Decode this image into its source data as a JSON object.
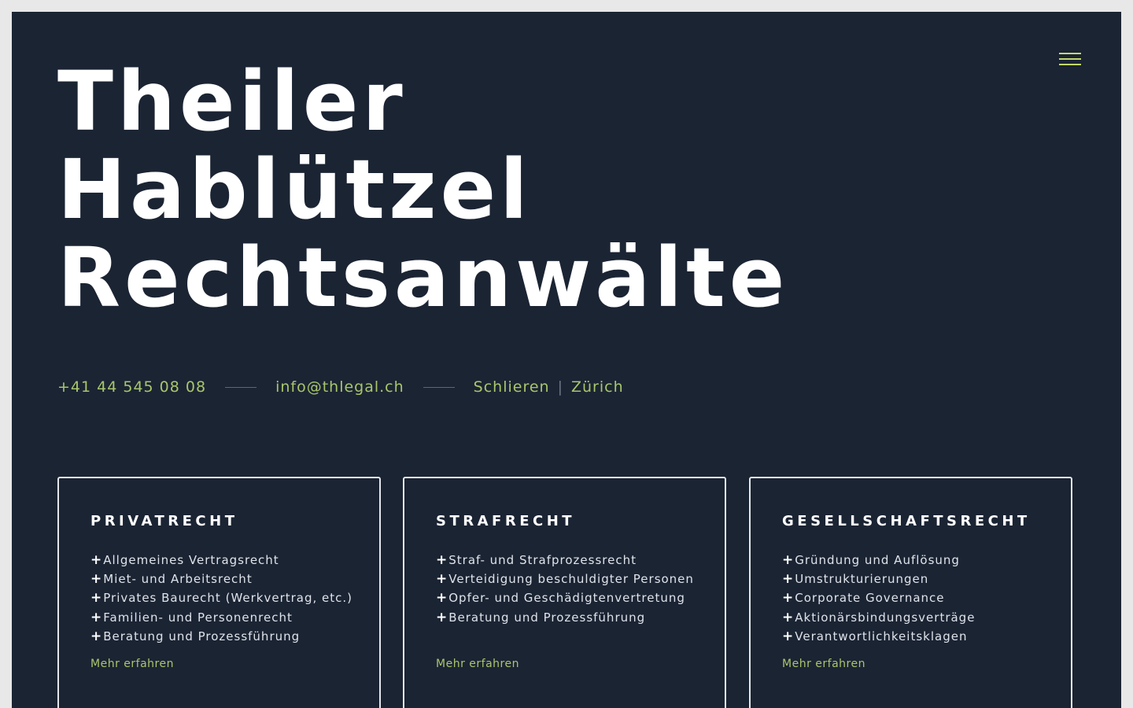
{
  "header": {
    "title_lines": [
      "Theiler",
      "Hablützel",
      "Rechtsanwälte"
    ],
    "menu_icon": "hamburger-menu-icon"
  },
  "contact": {
    "phone": "+41 44 545 08 08",
    "email": "info@thlegal.ch",
    "location_1": "Schlieren",
    "separator": "|",
    "location_2": "Zürich"
  },
  "cards": [
    {
      "title": "PRIVATRECHT",
      "items": [
        "Allgemeines Vertragsrecht",
        "Miet- und Arbeitsrecht",
        "Privates Baurecht (Werkvertrag, etc.)",
        "Familien- und Personenrecht",
        "Beratung und Prozessführung"
      ],
      "link": "Mehr erfahren"
    },
    {
      "title": "STRAFRECHT",
      "items": [
        "Straf- und Strafprozessrecht",
        "Verteidigung beschuldigter Personen",
        "Opfer- und Geschädigtenvertretung",
        "Beratung und Prozessführung"
      ],
      "link": "Mehr erfahren"
    },
    {
      "title": "GESELLSCHAFTSRECHT",
      "items": [
        "Gründung und Auflösung",
        "Umstrukturierungen",
        "Corporate Governance",
        "Aktionärsbindungsverträge",
        "Verantwortlichkeitsklagen"
      ],
      "link": "Mehr erfahren"
    }
  ],
  "bullet_symbol": "+",
  "colors": {
    "background": "#1b2433",
    "accent": "#a8c66c",
    "menu_accent": "#c2d96a",
    "text": "#ffffff"
  }
}
